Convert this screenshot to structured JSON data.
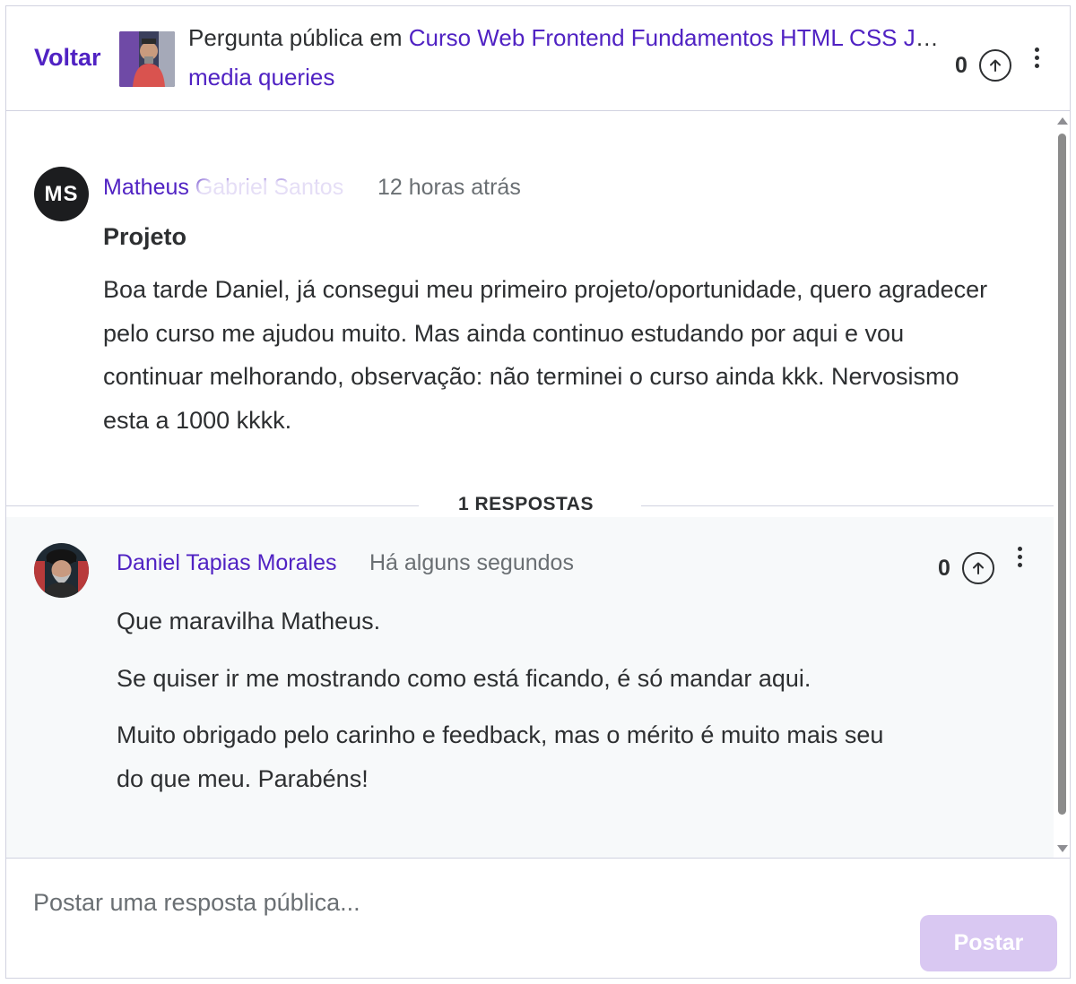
{
  "header": {
    "back_label": "Voltar",
    "prefix": "Pergunta pública em",
    "course_name": "Curso Web Frontend Fundamentos HTML CSS JavaScript",
    "lecture_name": "media queries",
    "upvote_count": "0"
  },
  "question": {
    "author_initials": "MS",
    "author_name": "Matheus Gabriel Santos",
    "time_ago": "12 horas atrás",
    "title": "Projeto",
    "body": "Boa tarde Daniel, já consegui meu primeiro projeto/oportunidade, quero agradecer pelo curso me ajudou muito. Mas ainda continuo estudando por aqui e vou continuar melhorando, observação: não terminei o curso ainda kkk.  Nervosismo esta a 1000 kkkk."
  },
  "responses_label": "1 RESPOSTAS",
  "answer": {
    "author_name": "Daniel Tapias Morales",
    "time_ago": "Há alguns segundos",
    "upvote_count": "0",
    "paragraphs": [
      "Que maravilha Matheus.",
      "Se quiser ir me mostrando como está ficando, é só mandar aqui.",
      "Muito obrigado pelo carinho e feedback, mas o mérito é muito mais seu do que meu. Parabéns!"
    ]
  },
  "reply": {
    "placeholder": "Postar uma resposta pública...",
    "post_label": "Postar"
  },
  "colors": {
    "accent": "#5022c3",
    "post_button_disabled": "#d9c8f2",
    "answer_background": "#f7f9fa"
  }
}
